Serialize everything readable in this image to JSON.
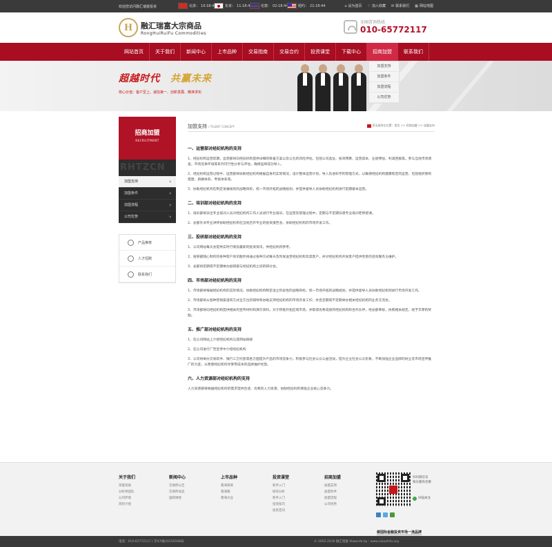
{
  "topbar": {
    "welcome": "欢迎您访问融汇瑞富投资",
    "clocks": [
      {
        "flag": "cn-flag-icon",
        "city": "北京：",
        "time": "10:18:44"
      },
      {
        "flag": "jp-flag-icon",
        "city": "东京：",
        "time": "11:18:44"
      },
      {
        "flag": "uk-flag-icon",
        "city": "伦敦：",
        "time": "02:18:44"
      },
      {
        "flag": "us-flag-icon",
        "city": "纽约：",
        "time": "21:18:44"
      }
    ],
    "links": [
      "设为首页",
      "加入收藏",
      "联系我们",
      "网站地图"
    ]
  },
  "header": {
    "logo_cn": "融汇瑞富大宗商品",
    "logo_en": "RongHuiRuiFu Commodities",
    "hotline_label": "全国咨询热线",
    "hotline_number": "010-65772117"
  },
  "nav": {
    "items": [
      "网站首页",
      "关于我们",
      "新闻中心",
      "上市品种",
      "交易指南",
      "交易合约",
      "投资课堂",
      "下载中心",
      "招商加盟",
      "联系我们"
    ],
    "active_index": 8,
    "dropdown": [
      "加盟支持",
      "加盟条件",
      "加盟流程",
      "公司优势"
    ]
  },
  "banner": {
    "slogan_a": "超越时代",
    "slogan_b": "共赢未来",
    "tagline": "核心价值：客户至上、诚信第一、创新发展、精准求实"
  },
  "sidebar": {
    "title": "招商加盟",
    "subtitle": "RECRUITMENT",
    "watermark": "RHTZCN",
    "items": [
      "加盟支持",
      "加盟条件",
      "加盟流程",
      "公司优势"
    ],
    "links": [
      {
        "icon": "gear-icon",
        "label": "产品推荐"
      },
      {
        "icon": "people-icon",
        "label": "人才招聘"
      },
      {
        "icon": "phone-icon",
        "label": "联系我们"
      }
    ]
  },
  "main": {
    "title": "加盟支持",
    "title_en": "/ TALENT CONCEPT",
    "breadcrumb": "您当前所在位置：首页 >> 招商加盟 >> 加盟支持",
    "sections": [
      {
        "heading": "一、运营部对经纪机构的支持",
        "paras": [
          "1、经纪机构运营前期，运营部将向经纪机构提供详细的筹备方案以及公允的风险评估，包括公司选址、投资预算、运营成本、业绩预估、利润回报等。参与当地市场调查，市场竞争环境等系列可行性分析与评估，确保品牌成功导入。",
          "2、经纪机构运营过程中，运营部将协助经纪机构根据自身的实际情况，设计整体运营计划，导入先进科学的管理方式，以确保经纪机构健康稳定的运营，包括组织架构搭建、薪酬体系、考核体系等。",
          "3、协助经纪机构在制定发展规划的战略目标，统一市场开拓的战略规划，并提供督导人员协助经纪机构进行前期基本运营。"
        ]
      },
      {
        "heading": "二、培训部对经纪机构的支持",
        "paras": [
          "1、培训部将派出专业培训人员对经纪机构工作人员进行专业培训，在运营及管理过程中，定期与不定期派遣专业培训老师授课。",
          "2、总部外派专业讲师协助经纪机构在当地召开专业的投资报告会，协助经纪机构的市场开发工作。"
        ]
      },
      {
        "heading": "三、投研部对经纪机构的支持",
        "paras": [
          "1、公司网站每天会提供实时行情及最新的投资资讯，供经纪机构参考。",
          "2、投研部随心制作的各种客户资讯服务将通过各种方式每天及时发送至经纪机构及其客户，并对经纪机构开发客户提供完善的咨询服务与维护。",
          "3、总部将定期或不定期举办投研部与经纪机构之间的研讨会。"
        ]
      },
      {
        "heading": "四、市场部对经纪机构的支持",
        "paras": [
          "1、市场部将根据经纪机构的实际情况，协助经纪机构制定设立阶段性的战略目标，统一市场开拓的战略规划，并提供督导人员协助经纪机构进行市场开发工作。",
          "2、市场部将从各种营销渠道和方式全方位的辅导和协助支持经纪机构的市场开发工作；并且定期或不定期举办相关经纪机构的业务交流会。",
          "3、市场部将向经纪机构提供相关的宣传材料和演示资料。对于积极开拓区域市场，并取得优秀成绩的经纪机构和合作伙伴，经总部审核，依照相关规定，给予丰厚的奖励。"
        ]
      },
      {
        "heading": "五、推广部对经纪机构的支持",
        "paras": [
          "1、在公司网站上介绍经纪机构与其网站链接",
          "2、在公司进行广告宣传中介绍经纪机构",
          "3、公司将举办交易软件、银行三方托管等各方面提升产品的市场竞争力，积极参与社会公众公益活动，提升企业社会公众形象，不断加强企业品牌的树立及市场宣传推广的力度，从而使经纪机构享受零成本的品牌维护优势。"
        ]
      },
      {
        "heading": "六、人力资源部对经纪机构的支持",
        "paras": [
          "人力资源部将根据经纪机构的需求提供合适、优秀的人力资源，协助经纪机构增强企业核心竞争力。"
        ]
      }
    ]
  },
  "footer": {
    "cols": [
      {
        "title": "关于我们",
        "items": [
          "荣誉资质",
          "分析师团队",
          "公司环境",
          "风险介绍"
        ]
      },
      {
        "title": "新闻中心",
        "items": [
          "交易所公告",
          "交易所动态",
          "国际财经"
        ]
      },
      {
        "title": "上市品种",
        "items": [
          "南海燕窝",
          "南海银",
          "南海大豆"
        ]
      },
      {
        "title": "投资课堂",
        "items": [
          "新手入门",
          "研究分析",
          "新手入门",
          "投资技巧",
          "投资百问"
        ]
      },
      {
        "title": "招商加盟",
        "items": [
          "加盟支持",
          "加盟条件",
          "加盟流程",
          "公司优势"
        ]
      }
    ],
    "qr_text": [
      "扫扫微信号",
      "每天都有优惠"
    ],
    "qr_follow": "扫描关注",
    "slogan": "做国际金融投资市场一流品牌",
    "bottom_left": "电话：010-65772117 | 京ICP备20156598号",
    "bottom_right": "© 2002-2016 融汇瑞富 Powerde by : www.xiaozhifu.org"
  }
}
